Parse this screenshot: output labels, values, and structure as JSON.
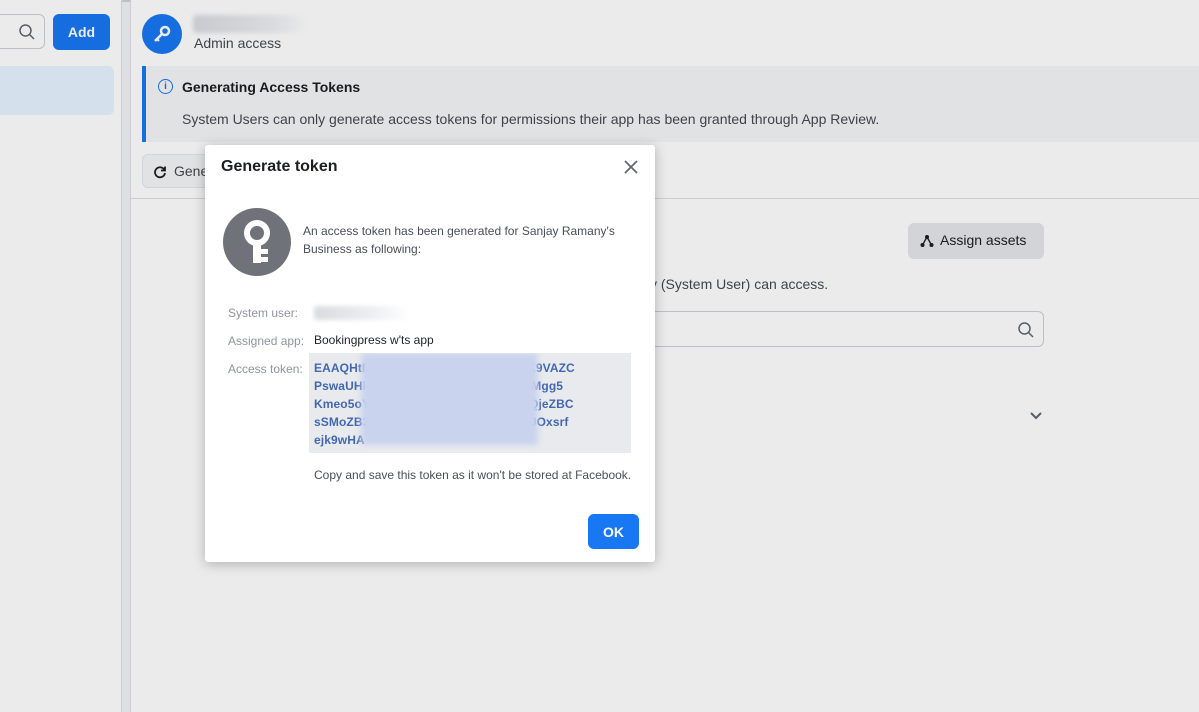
{
  "left_panel": {
    "add_label": "Add"
  },
  "header": {
    "role": "Admin access"
  },
  "banner": {
    "title": "Generating Access Tokens",
    "body": "System Users can only generate access tokens for permissions their app has been granted through App Review."
  },
  "toolbar": {
    "generate_label_partial": "Gene"
  },
  "assets": {
    "assign_label": "Assign assets",
    "description_partial": "y (System User) can access."
  },
  "modal": {
    "title": "Generate token",
    "intro": "An access token has been generated for Sanjay Ramany's Business as following:",
    "system_user_label": "System user:",
    "assigned_app_label": "Assigned app:",
    "assigned_app_value": "Bookingpress w'ts app",
    "access_token_label": "Access token:",
    "token_lines": [
      "EAAQHtM                              3sB5bReK9VAZC",
      "PswaUHl                              FlJ0nmpzzMgg5",
      "Kmeo5oY                              Lc3JyQtVQjeZBC",
      "sSMoZB3                              jDMzdYfwJOxsrf",
      "ejk9wHA"
    ],
    "warning": "Copy and save this token as it won't be stored at Facebook.",
    "ok_label": "OK"
  },
  "colors": {
    "accent": "#1877f2",
    "token_text": "#4267b2",
    "key_circle": "#6f7278"
  },
  "icons": {
    "search": "search-icon",
    "close": "close-icon",
    "key": "key-icon",
    "info": "info-icon",
    "refresh": "refresh-icon",
    "assign": "people-network-icon",
    "chevron": "chevron-down-icon"
  }
}
